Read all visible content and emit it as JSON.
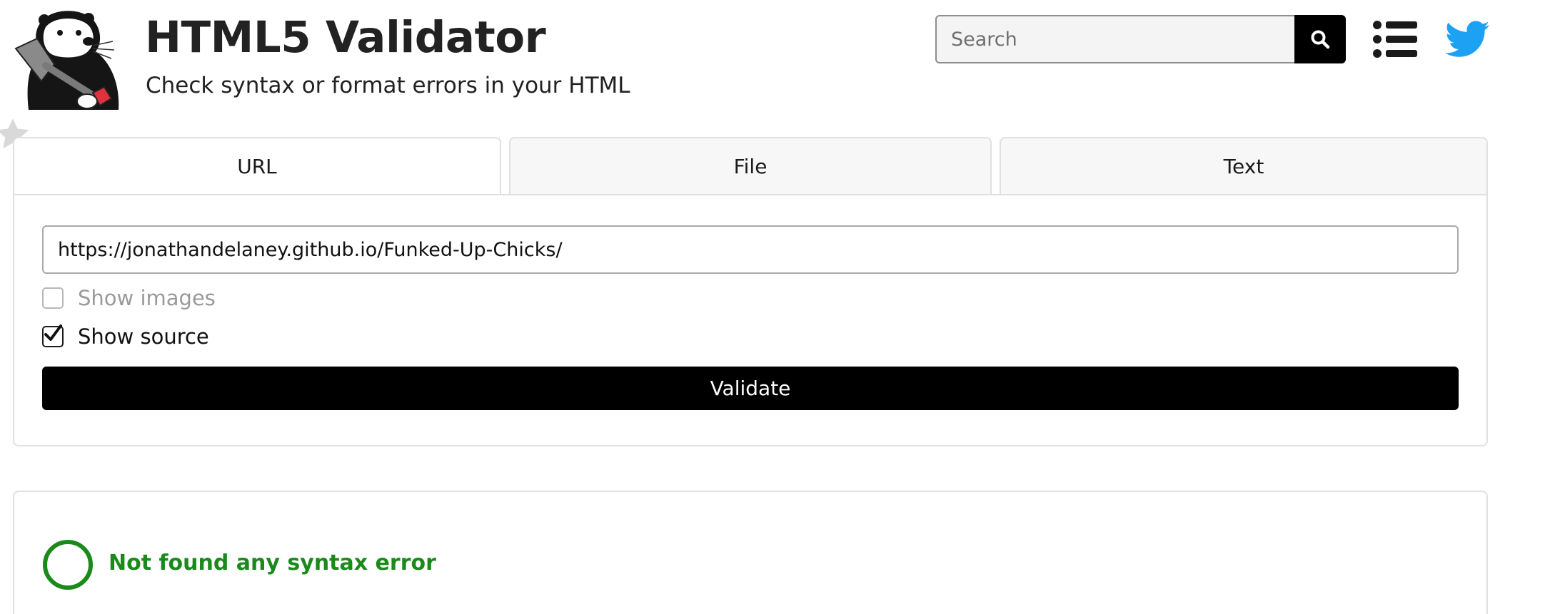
{
  "header": {
    "title": "HTML5 Validator",
    "subtitle": "Check syntax or format errors in your HTML",
    "logo_icon": "otter-with-shovel-logo",
    "search": {
      "placeholder": "Search",
      "value": ""
    },
    "search_icon": "search-icon",
    "menu_icon": "list-menu-icon",
    "twitter_icon": "twitter-bird-icon",
    "twitter_color": "#1da1f2"
  },
  "tabs": [
    {
      "label": "URL",
      "active": true
    },
    {
      "label": "File",
      "active": false
    },
    {
      "label": "Text",
      "active": false
    }
  ],
  "form": {
    "url_value": "https://jonathandelaney.github.io/Funked-Up-Chicks/",
    "show_images": {
      "label": "Show images",
      "checked": false
    },
    "show_source": {
      "label": "Show source",
      "checked": true
    },
    "validate_label": "Validate"
  },
  "result": {
    "message": "Not found any syntax error",
    "status_color": "#1a8a1a",
    "icon": "success-circle-icon"
  }
}
